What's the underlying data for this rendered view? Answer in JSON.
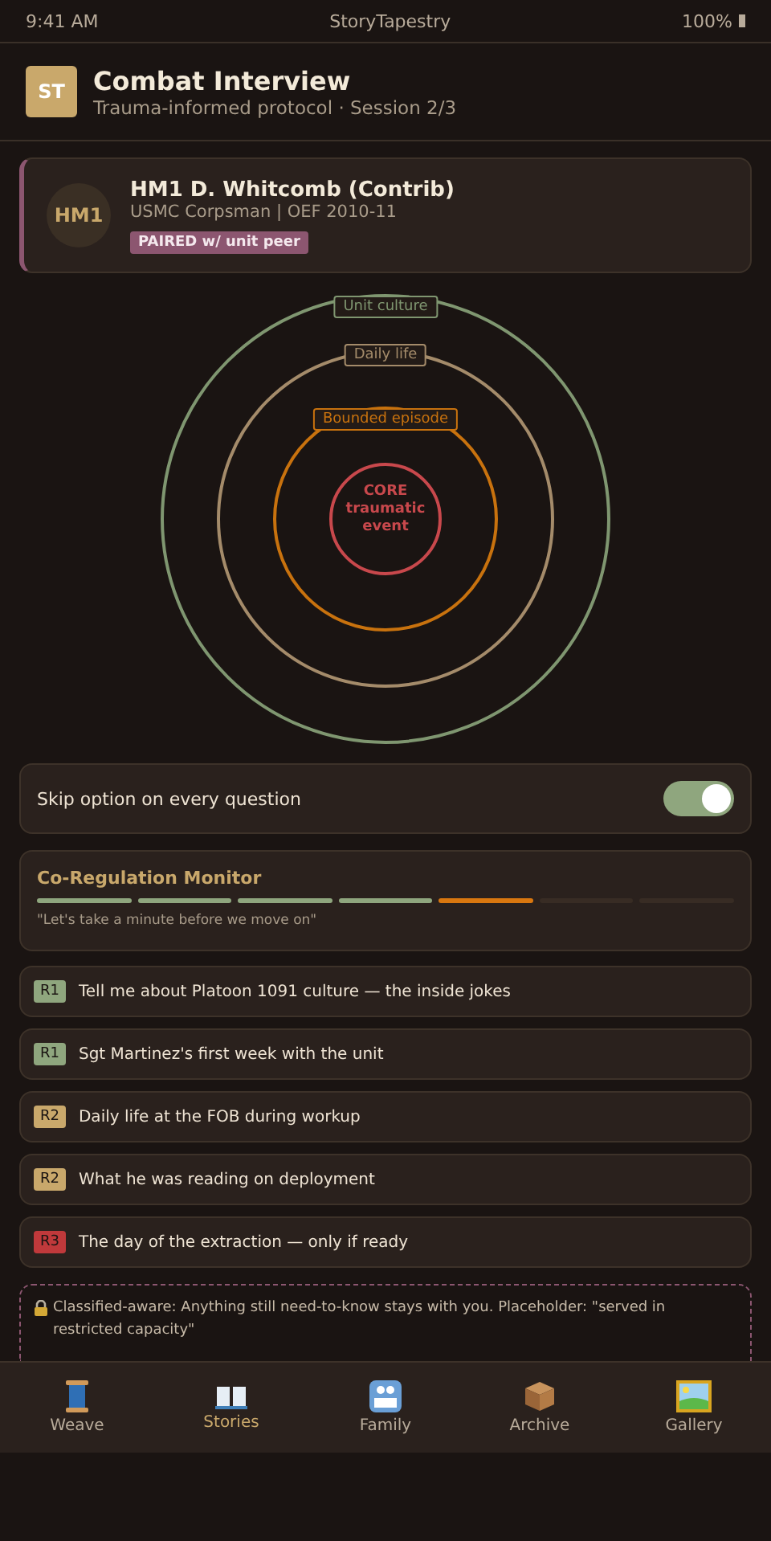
{
  "status_bar": {
    "time": "9:41 AM",
    "app": "StoryTapestry",
    "battery": "100%"
  },
  "header": {
    "logo": "ST",
    "title": "Combat Interview",
    "subtitle": "Trauma-informed protocol · Session 2/3"
  },
  "contributor": {
    "initials": "HM1",
    "name": "HM1 D. Whitcomb (Contrib)",
    "role": "USMC Corpsman | OEF 2010-11",
    "badge": "PAIRED w/ unit peer"
  },
  "rings": [
    {
      "label": "Unit culture",
      "color": "#7f9670"
    },
    {
      "label": "Daily life",
      "color": "#a48b6a"
    },
    {
      "label": "Bounded episode",
      "color": "#c8720e"
    },
    {
      "label": "CORE traumatic event",
      "color": "#c8484c"
    }
  ],
  "skip_toggle": {
    "label": "Skip option on every question",
    "on": true
  },
  "monitor": {
    "title": "Co-Regulation Monitor",
    "segments": [
      {
        "color": "#8fa67e"
      },
      {
        "color": "#8fa67e"
      },
      {
        "color": "#8fa67e"
      },
      {
        "color": "#8fa67e"
      },
      {
        "color": "#d9770f"
      },
      {
        "color": "#382c24"
      },
      {
        "color": "#382c24"
      }
    ],
    "quote": "\"Let's take a minute before we move on\""
  },
  "questions": [
    {
      "tag": "R1",
      "color": "#8fa67e",
      "text": "Tell me about Platoon 1091 culture — the inside jokes"
    },
    {
      "tag": "R1",
      "color": "#8fa67e",
      "text": "Sgt Martinez's first week with the unit"
    },
    {
      "tag": "R2",
      "color": "#c9a86b",
      "text": "Daily life at the FOB during workup"
    },
    {
      "tag": "R2",
      "color": "#c9a86b",
      "text": "What he was reading on deployment"
    },
    {
      "tag": "R3",
      "color": "#c0393b",
      "text": "The day of the extraction — only if ready"
    }
  ],
  "notice": "Classified-aware: Anything still need-to-know stays with you. Placeholder: \"served in restricted capacity\"",
  "tabs": [
    {
      "label": "Weave",
      "kind": "spool",
      "selected": false
    },
    {
      "label": "Stories",
      "kind": "book",
      "selected": true
    },
    {
      "label": "Family",
      "kind": "family",
      "selected": false
    },
    {
      "label": "Archive",
      "kind": "box",
      "selected": false
    },
    {
      "label": "Gallery",
      "kind": "frame",
      "selected": false
    }
  ]
}
